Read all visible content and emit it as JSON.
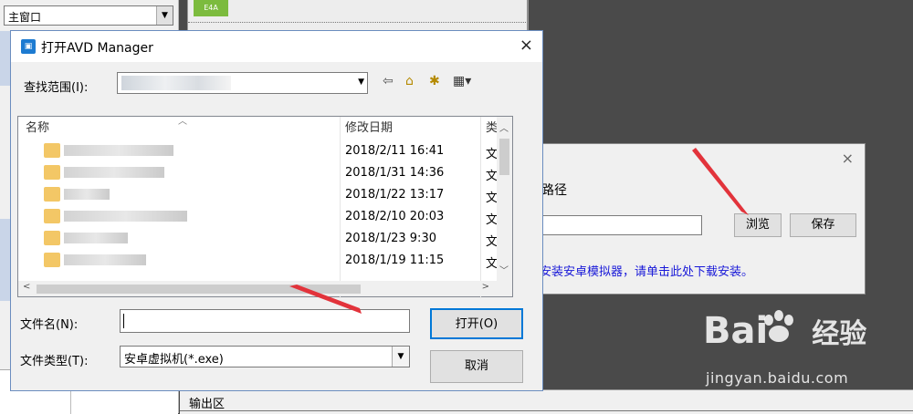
{
  "ide": {
    "window_combo": "主窗口",
    "logo_text": "E4A",
    "output_label": "输出区"
  },
  "settings_dialog": {
    "label": "器路径",
    "browse": "浏览",
    "save": "保存",
    "note": "安装安卓模拟器，请单击此处下载安装。",
    "close": "×"
  },
  "open_dialog": {
    "title": "打开AVD Manager",
    "close": "×",
    "look_in_label": "查找范围(I):",
    "columns": {
      "name": "名称",
      "date": "修改日期",
      "type": "类型"
    },
    "rows": [
      {
        "date": "2018/2/11 16:41",
        "type": "文件"
      },
      {
        "date": "2018/1/31 14:36",
        "type": "文件"
      },
      {
        "date": "2018/1/22 13:17",
        "type": "文件"
      },
      {
        "date": "2018/2/10 20:03",
        "type": "文件"
      },
      {
        "date": "2018/1/23 9:30",
        "type": "文件"
      },
      {
        "date": "2018/1/19 11:15",
        "type": "文件"
      }
    ],
    "filename_label": "文件名(N):",
    "filename_value": "",
    "filetype_label": "文件类型(T):",
    "filetype_value": "安卓虚拟机(*.exe)",
    "open_button": "打开(O)",
    "cancel_button": "取消"
  },
  "watermark": {
    "brand": "Bai",
    "brand2": "经验",
    "url": "jingyan.baidu.com"
  },
  "colors": {
    "annotation_arrow": "#e2333b",
    "link": "#1818d8",
    "focus": "#0078d7"
  }
}
